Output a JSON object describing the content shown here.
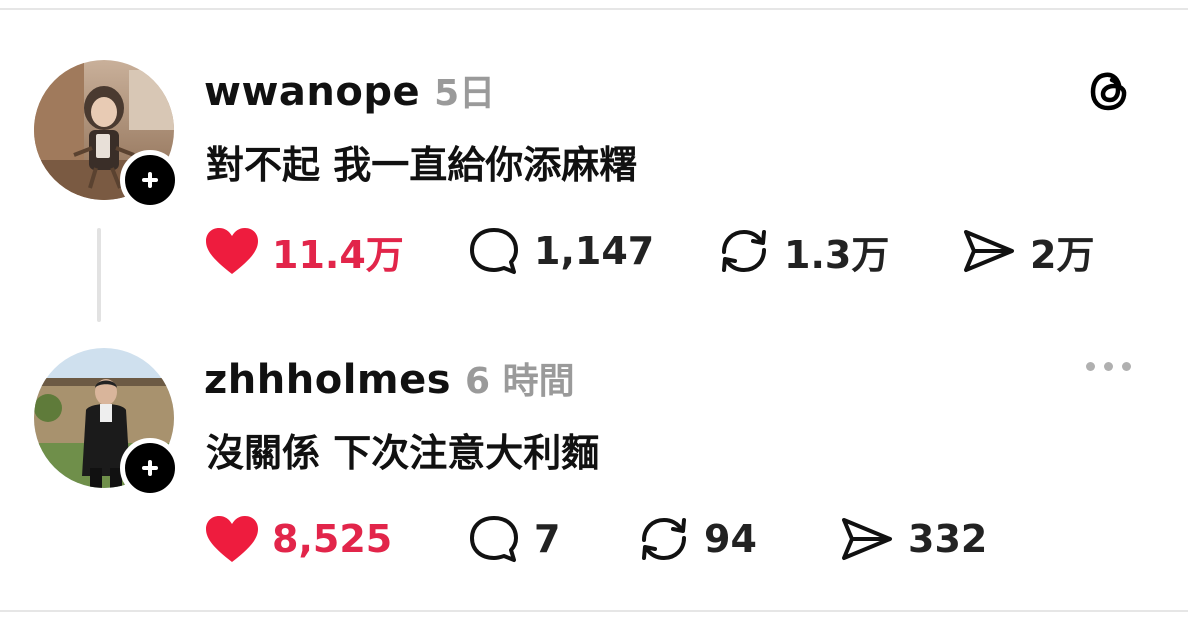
{
  "posts": [
    {
      "username": "wwanope",
      "time": "5日",
      "text": "對不起 我一直給你添麻糬",
      "likes": "11.4万",
      "comments": "1,147",
      "reposts": "1.3万",
      "shares": "2万"
    },
    {
      "username": "zhhholmes",
      "time": "6 時間",
      "text": "沒關係 下次注意大利麵",
      "likes": "8,525",
      "comments": "7",
      "reposts": "94",
      "shares": "332"
    }
  ],
  "icons": {
    "like": "heart-icon",
    "comment": "comment-bubble-icon",
    "repost": "repost-icon",
    "share": "send-icon",
    "brand": "threads-logo-icon",
    "more": "more-options-icon",
    "follow": "plus-icon"
  },
  "colors": {
    "like": "#e2254a",
    "muted": "#9a9a9a",
    "text": "#111111"
  }
}
